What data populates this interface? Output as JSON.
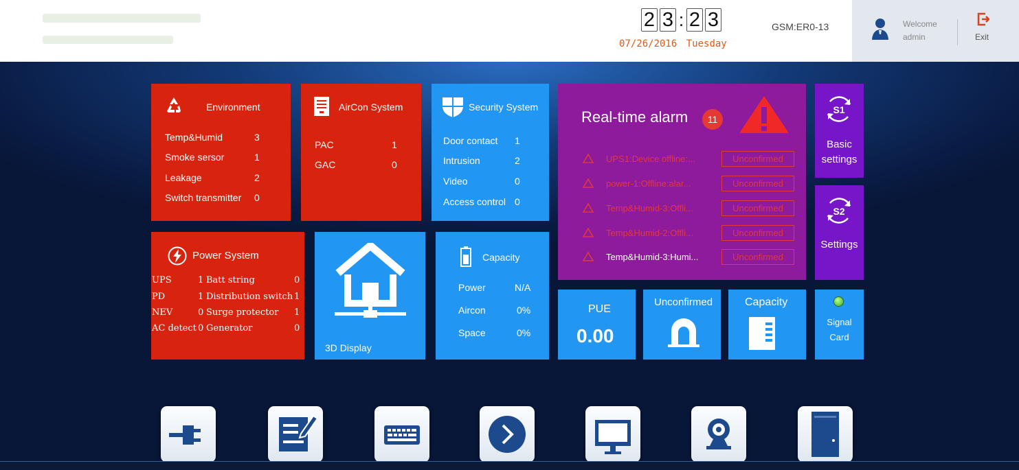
{
  "header": {
    "clock_digits": [
      "2",
      "3",
      "2",
      "3"
    ],
    "clock_separator": ":",
    "date": "07/26/2016",
    "weekday": "Tuesday",
    "device": "GSM:ER0-13",
    "welcome_label": "Welcome",
    "username": "admin",
    "exit_label": "Exit"
  },
  "environment": {
    "title": "Environment",
    "items": [
      {
        "label": "Temp&Humid",
        "value": "3"
      },
      {
        "label": "Smoke sersor",
        "value": "1"
      },
      {
        "label": "Leakage",
        "value": "2"
      },
      {
        "label": "Switch transmitter",
        "value": "0"
      }
    ]
  },
  "aircon": {
    "title": "AirCon System",
    "items": [
      {
        "label": "PAC",
        "value": "1"
      },
      {
        "label": "GAC",
        "value": "0"
      }
    ]
  },
  "security": {
    "title": "Security System",
    "items": [
      {
        "label": "Door contact",
        "value": "1"
      },
      {
        "label": "Intrusion",
        "value": "2"
      },
      {
        "label": "Video",
        "value": "0"
      },
      {
        "label": "Access control",
        "value": "0"
      }
    ]
  },
  "alarm": {
    "title": "Real-time alarm",
    "count": "11",
    "rows": [
      {
        "text": "UPS1:Device offline:...",
        "status": "Unconfirmed"
      },
      {
        "text": "power-1:Offline:alar...",
        "status": "Unconfirmed"
      },
      {
        "text": "Temp&Humid-3:Offli...",
        "status": "Unconfirmed"
      },
      {
        "text": "Temp&Humid-2:Offli...",
        "status": "Unconfirmed"
      },
      {
        "text": "Temp&Humid-3:Humi...",
        "status": "Unconfirmed"
      }
    ]
  },
  "side": {
    "s1_label": "S1",
    "basic_line1": "Basic",
    "basic_line2": "settings",
    "s2_label": "S2",
    "settings": "Settings",
    "signal_line1": "Signal",
    "signal_line2": "Card"
  },
  "power": {
    "title": "Power System",
    "left": [
      {
        "label": "UPS",
        "value": "1"
      },
      {
        "label": "PD",
        "value": "1"
      },
      {
        "label": "NEV",
        "value": "0"
      },
      {
        "label": "AC detect",
        "value": "0"
      }
    ],
    "right": [
      {
        "label": "Batt string",
        "value": "0"
      },
      {
        "label": "Distribution switch",
        "value": "1"
      },
      {
        "label": "Surge protector",
        "value": "1"
      },
      {
        "label": "Generator",
        "value": "0"
      }
    ]
  },
  "display3d": {
    "label": "3D Display"
  },
  "capacity": {
    "title": "Capacity",
    "items": [
      {
        "label": "Power",
        "value": "N/A"
      },
      {
        "label": "Aircon",
        "value": "0%"
      },
      {
        "label": "Space",
        "value": "0%"
      }
    ]
  },
  "pue": {
    "label": "PUE",
    "value": "0.00"
  },
  "unconfirmed": {
    "label": "Unconfirmed"
  },
  "capacity2": {
    "label": "Capacity"
  },
  "dock": [
    "plug-icon",
    "edit-icon",
    "keyboard-icon",
    "arrow-icon",
    "monitor-icon",
    "webcam-icon",
    "cabinet-icon"
  ],
  "colors": {
    "red": "#d8240f",
    "blue": "#2196f3",
    "purple": "#8e1a9c",
    "violet": "#7616c8",
    "alarm": "#e03a3a",
    "date": "#e05a11"
  }
}
